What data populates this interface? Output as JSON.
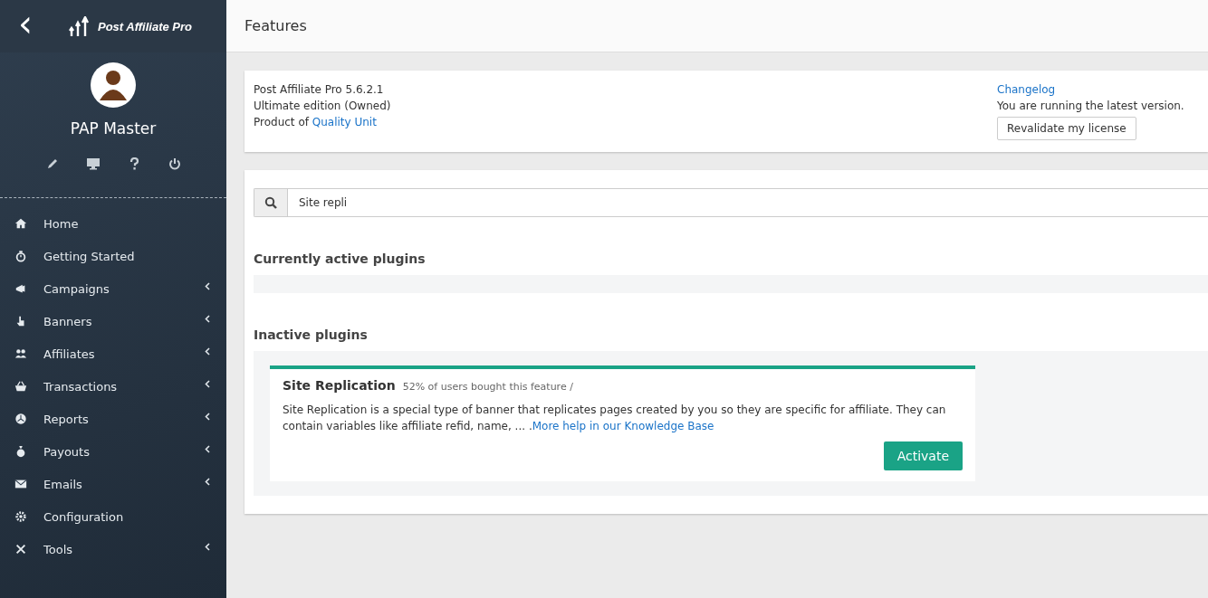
{
  "sidebar": {
    "back": "‹",
    "logo": "Post Affiliate Pro",
    "user": "PAP Master",
    "nav": [
      {
        "label": "Home",
        "expandable": false
      },
      {
        "label": "Getting Started",
        "expandable": false
      },
      {
        "label": "Campaigns",
        "expandable": true
      },
      {
        "label": "Banners",
        "expandable": true
      },
      {
        "label": "Affiliates",
        "expandable": true
      },
      {
        "label": "Transactions",
        "expandable": true
      },
      {
        "label": "Reports",
        "expandable": true
      },
      {
        "label": "Payouts",
        "expandable": true
      },
      {
        "label": "Emails",
        "expandable": true
      },
      {
        "label": "Configuration",
        "expandable": false
      },
      {
        "label": "Tools",
        "expandable": true
      }
    ]
  },
  "page_title": "Features",
  "version_panel": {
    "version": "Post Affiliate Pro 5.6.2.1",
    "edition": "Ultimate edition (Owned)",
    "product_of": "Product of",
    "vendor_link": "Quality Unit",
    "changelog_link": "Changelog",
    "status": "You are running the latest version.",
    "revalidate_button": "Revalidate my license"
  },
  "search": {
    "value": "Site repli"
  },
  "active_section": {
    "title": "Currently active plugins"
  },
  "inactive_section": {
    "title": "Inactive plugins",
    "plugins": [
      {
        "name": "Site Replication",
        "stats": "52% of users bought this feature /",
        "description": "Site Replication is a special type of banner that replicates pages created by you so they are specific for affiliate. They can contain variables like affiliate refid, name, ... .",
        "help_link": "More help in our Knowledge Base",
        "button": "Activate"
      }
    ]
  }
}
